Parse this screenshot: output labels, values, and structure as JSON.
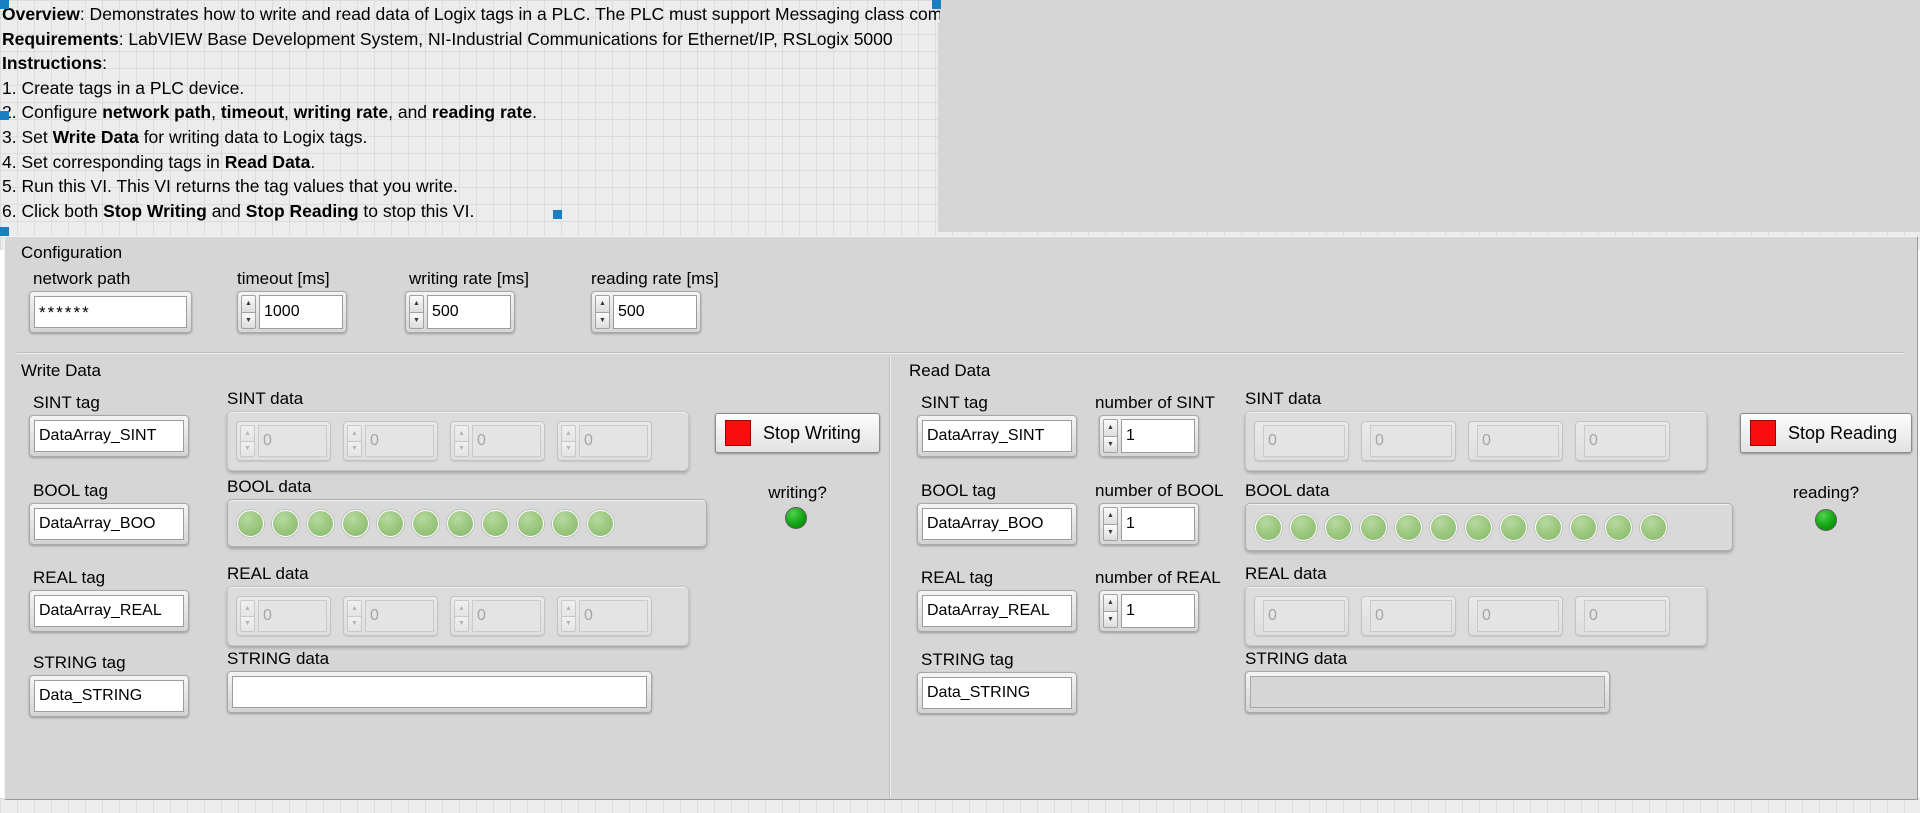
{
  "documentation": {
    "lines": [
      {
        "bold": "Overview",
        "rest": ": Demonstrates how to write and read data of Logix tags in a PLC. The PLC must support Messaging class communications."
      },
      {
        "bold": "Requirements",
        "rest": ": LabVIEW Base Development System, NI-Industrial Communications for Ethernet/IP, RSLogix 5000"
      },
      {
        "bold": "Instructions",
        "rest": ":"
      },
      {
        "bold": "",
        "rest": "1. Create tags in a PLC device."
      },
      {
        "bold": "",
        "rest": "2. Configure ",
        "mid_bold": "network path",
        "mid2": ", ",
        "mid_bold2": "timeout",
        "mid3": ", ",
        "mid_bold3": "writing rate",
        "mid4": ", and ",
        "mid_bold4": "reading rate",
        "tail": "."
      },
      {
        "bold": "",
        "rest": "3. Set ",
        "mid_bold": "Write Data",
        "tail": " for writing data to Logix tags."
      },
      {
        "bold": "",
        "rest": "4. Set corresponding tags in ",
        "mid_bold": "Read Data",
        "tail": "."
      },
      {
        "bold": "",
        "rest": "5. Run this VI. This VI returns the tag values that you write."
      },
      {
        "bold": "",
        "rest": "6. Click both ",
        "mid_bold": "Stop Writing",
        "mid2": " and ",
        "mid_bold2": "Stop Reading",
        "tail": " to stop this VI."
      }
    ],
    "line1_full": "Overview: Demonstrates how to write and read data of Logix tags in a PLC. The PLC must support Messaging class communications.",
    "line2_full": "Requirements: LabVIEW Base Development System, NI-Industrial Communications for Ethernet/IP, RSLogix 5000",
    "line3_full": "Instructions:",
    "line4_full": "1. Create tags in a PLC device.",
    "line5_full": "2. Configure network path, timeout, writing rate, and reading rate.",
    "line6_full": "3. Set Write Data for writing data to Logix tags.",
    "line7_full": "4. Set corresponding tags in Read Data.",
    "line8_full": "5. Run this VI. This VI returns the tag values that you write.",
    "line9_full": "6. Click both Stop Writing and Stop Reading to stop this VI."
  },
  "configuration": {
    "title": "Configuration",
    "network_path": {
      "label": "network path",
      "value": "******"
    },
    "timeout": {
      "label": "timeout [ms]",
      "value": "1000"
    },
    "writing_rate": {
      "label": "writing rate [ms]",
      "value": "500"
    },
    "reading_rate": {
      "label": "reading rate [ms]",
      "value": "500"
    }
  },
  "write_data": {
    "title": "Write Data",
    "sint": {
      "tag_label": "SINT tag",
      "tag_value": "DataArray_SINT",
      "data_label": "SINT data",
      "values": [
        "0",
        "0",
        "0",
        "0"
      ]
    },
    "bool": {
      "tag_label": "BOOL tag",
      "tag_value": "DataArray_BOO",
      "data_label": "BOOL data",
      "led_count": 11,
      "led_state": "off"
    },
    "real": {
      "tag_label": "REAL tag",
      "tag_value": "DataArray_REAL",
      "data_label": "REAL data",
      "values": [
        "0",
        "0",
        "0",
        "0"
      ]
    },
    "string": {
      "tag_label": "STRING tag",
      "tag_value": "Data_STRING",
      "data_label": "STRING data",
      "value": ""
    },
    "stop_button": "Stop Writing",
    "status_label": "writing?",
    "status_on": true
  },
  "read_data": {
    "title": "Read Data",
    "sint": {
      "tag_label": "SINT tag",
      "tag_value": "DataArray_SINT",
      "count_label": "number of SINT",
      "count_value": "1",
      "data_label": "SINT data",
      "values": [
        "0",
        "0",
        "0",
        "0"
      ]
    },
    "bool": {
      "tag_label": "BOOL tag",
      "tag_value": "DataArray_BOO",
      "count_label": "number of BOOL",
      "count_value": "1",
      "data_label": "BOOL data",
      "led_count": 12,
      "led_state": "off"
    },
    "real": {
      "tag_label": "REAL tag",
      "tag_value": "DataArray_REAL",
      "count_label": "number of REAL",
      "count_value": "1",
      "data_label": "REAL data",
      "values": [
        "0",
        "0",
        "0",
        "0"
      ]
    },
    "string": {
      "tag_label": "STRING tag",
      "tag_value": "Data_STRING",
      "data_label": "STRING data",
      "value": ""
    },
    "stop_button": "Stop Reading",
    "status_label": "reading?",
    "status_on": true
  },
  "colors": {
    "panel_bg": "#d6d6d6",
    "grid_bg": "#ececed",
    "stop_red": "#fb0d0d",
    "led_on_green": "#12a512",
    "led_off_green": "#9cc87f",
    "selection_blue": "#1a7fc1"
  },
  "icons": {
    "spinner_up": "▲",
    "spinner_down": "▼"
  }
}
